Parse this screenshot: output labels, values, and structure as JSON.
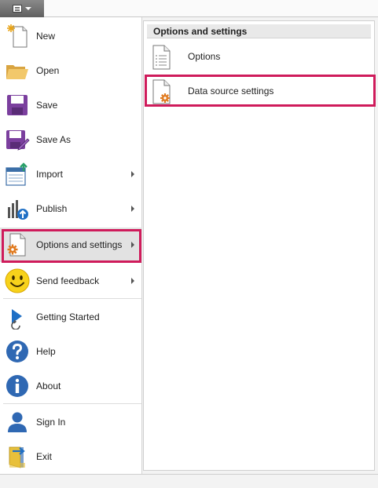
{
  "file_button": {
    "icon": "file-menu-icon"
  },
  "menu": {
    "items": [
      {
        "label": "New",
        "icon": "new-icon",
        "has_submenu": false
      },
      {
        "label": "Open",
        "icon": "folder-icon",
        "has_submenu": false
      },
      {
        "label": "Save",
        "icon": "save-icon",
        "has_submenu": false
      },
      {
        "label": "Save As",
        "icon": "save-as-icon",
        "has_submenu": false
      },
      {
        "label": "Import",
        "icon": "import-icon",
        "has_submenu": true
      },
      {
        "label": "Publish",
        "icon": "publish-icon",
        "has_submenu": true
      },
      {
        "label": "Options and settings",
        "icon": "options-settings-icon",
        "has_submenu": true
      },
      {
        "label": "Send feedback",
        "icon": "smiley-icon",
        "has_submenu": true
      },
      {
        "label": "Getting Started",
        "icon": "getting-started-icon",
        "has_submenu": false
      },
      {
        "label": "Help",
        "icon": "help-icon",
        "has_submenu": false
      },
      {
        "label": "About",
        "icon": "info-icon",
        "has_submenu": false
      },
      {
        "label": "Sign In",
        "icon": "user-icon",
        "has_submenu": false
      },
      {
        "label": "Exit",
        "icon": "exit-icon",
        "has_submenu": false
      }
    ]
  },
  "submenu": {
    "title": "Options and settings",
    "items": [
      {
        "label": "Options",
        "icon": "options-doc-icon"
      },
      {
        "label": "Data source settings",
        "icon": "data-source-settings-icon"
      }
    ]
  },
  "colors": {
    "highlight_border": "#cf1b5b",
    "selected_bg": "#e2e2e2"
  }
}
